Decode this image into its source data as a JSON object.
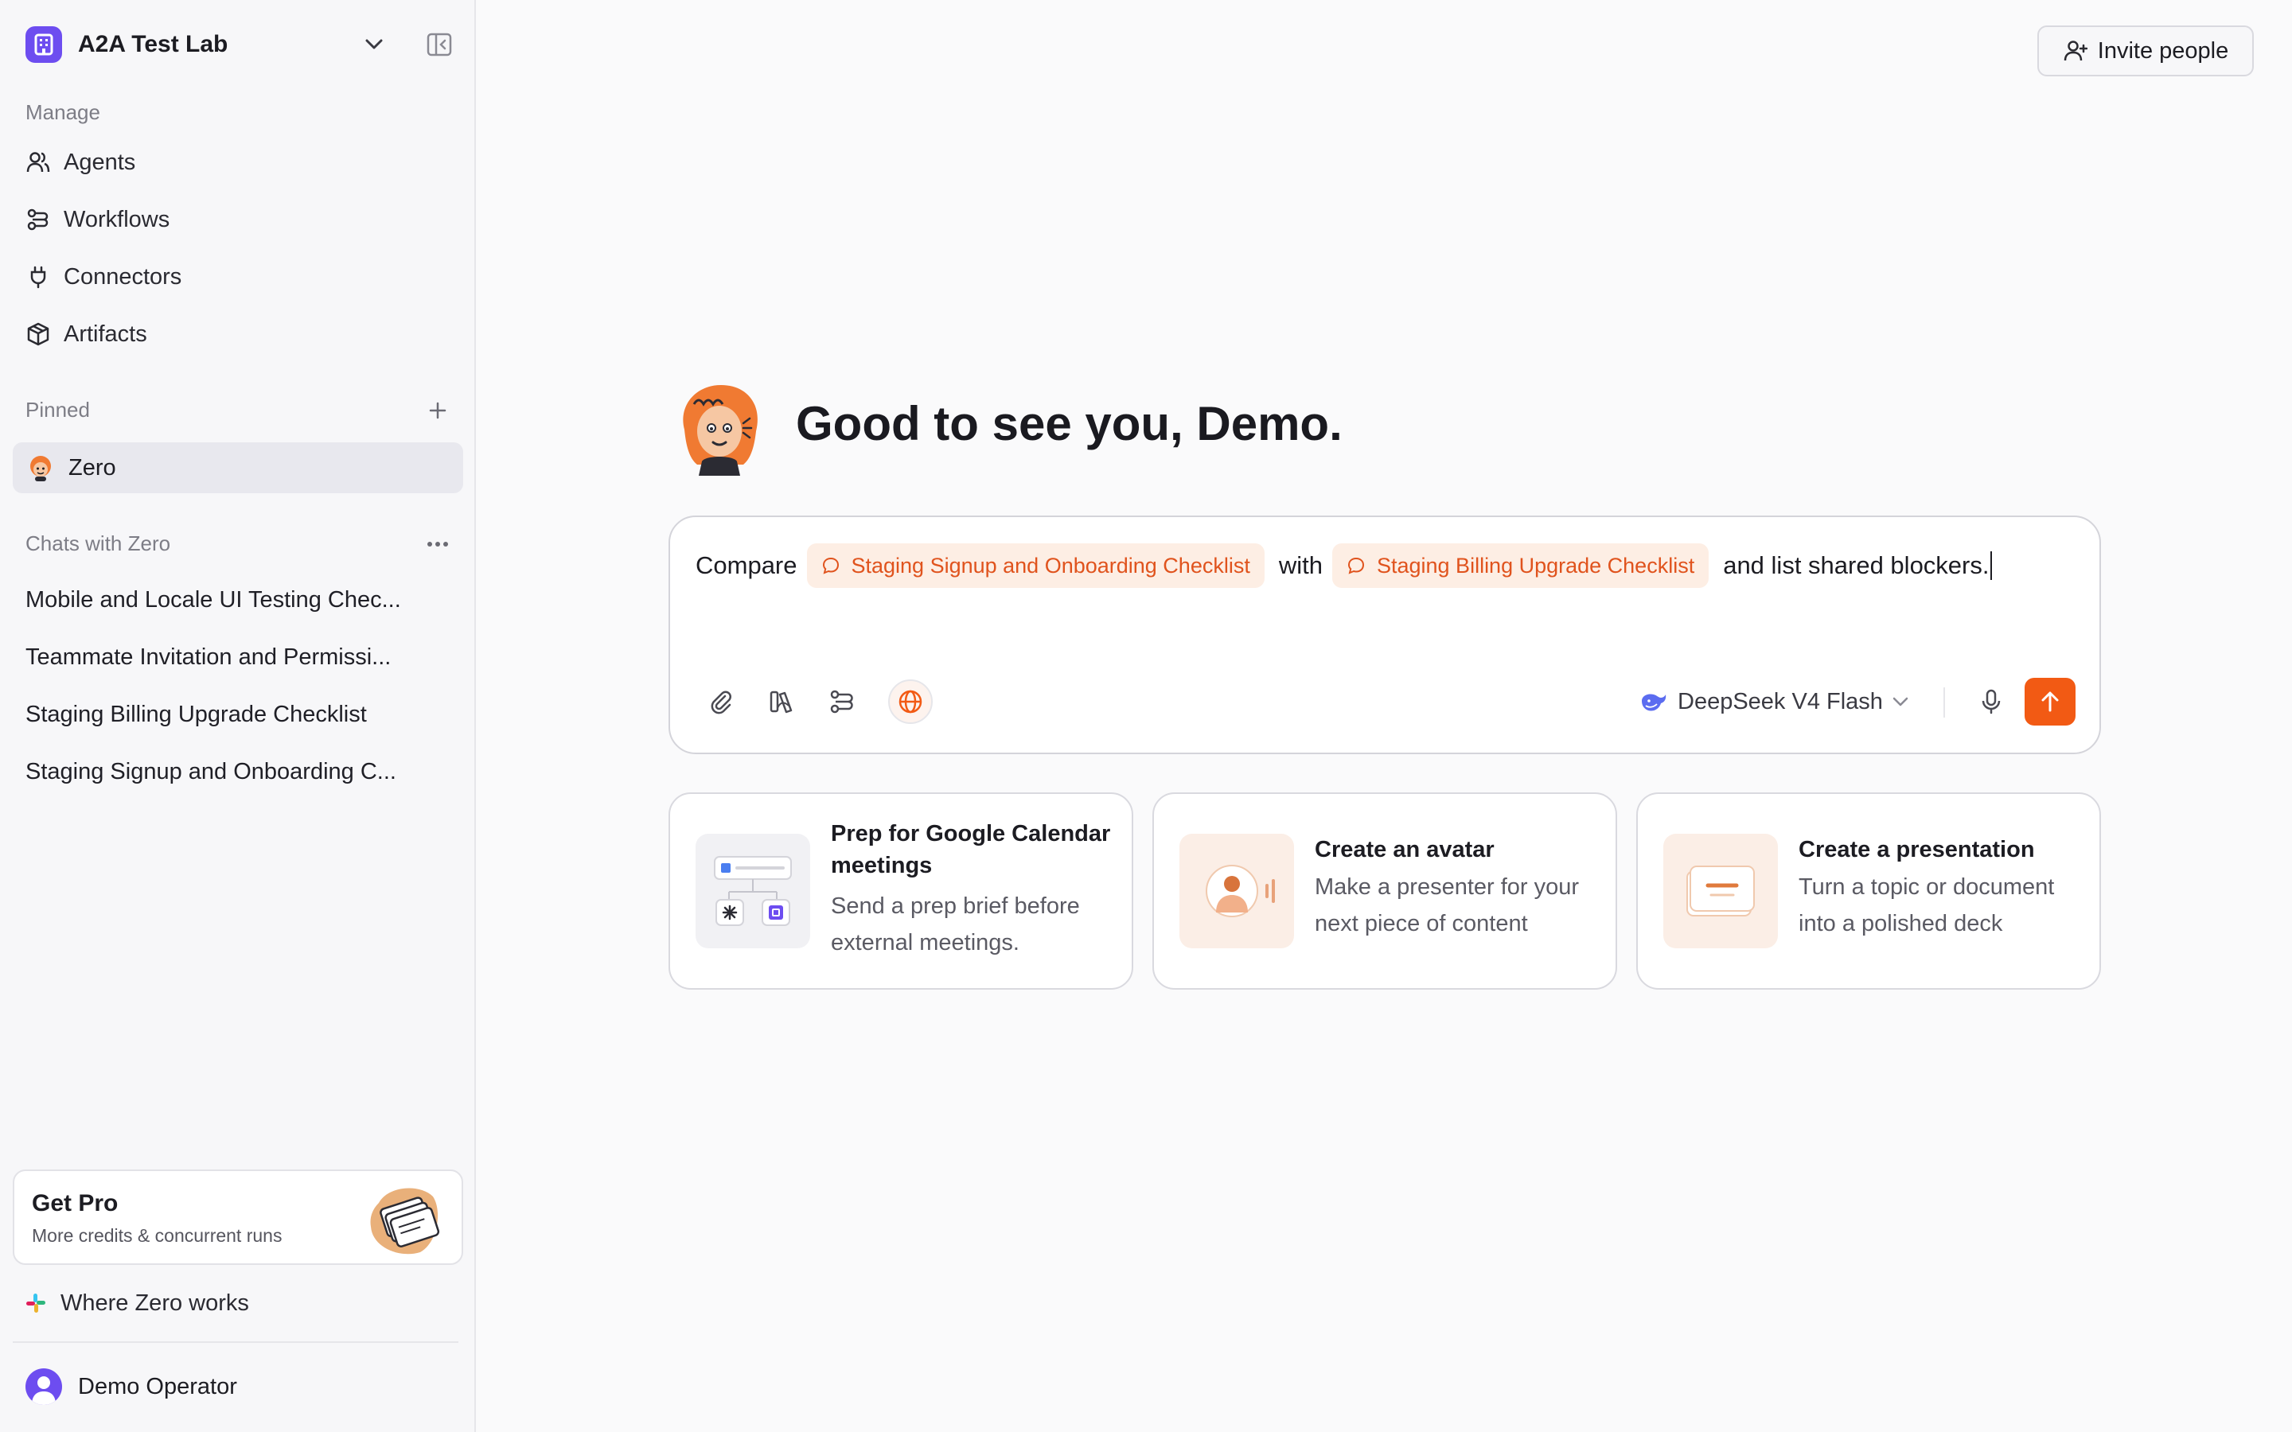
{
  "workspace": {
    "name": "A2A Test Lab",
    "logo_icon": "building-icon"
  },
  "sidebar": {
    "manage_label": "Manage",
    "manage_items": [
      {
        "label": "Agents",
        "icon": "users-icon"
      },
      {
        "label": "Workflows",
        "icon": "workflow-icon"
      },
      {
        "label": "Connectors",
        "icon": "plug-icon"
      },
      {
        "label": "Artifacts",
        "icon": "package-icon"
      }
    ],
    "pinned_label": "Pinned",
    "pinned_items": [
      {
        "label": "Zero"
      }
    ],
    "chats_label": "Chats with Zero",
    "chats": [
      "Mobile and Locale UI Testing Chec...",
      "Teammate Invitation and Permissi...",
      "Staging Billing Upgrade Checklist",
      "Staging Signup and Onboarding C..."
    ],
    "pro_card": {
      "title": "Get Pro",
      "subtitle": "More credits & concurrent runs"
    },
    "where_label": "Where Zero works",
    "user_name": "Demo Operator"
  },
  "header": {
    "invite_label": "Invite people"
  },
  "main": {
    "greeting": "Good to see you, Demo.",
    "composer": {
      "text_before": "Compare",
      "chip_1": "Staging Signup and Onboarding Checklist",
      "text_middle": "with",
      "chip_2": "Staging Billing Upgrade Checklist",
      "text_after": "and list shared blockers.",
      "model": "DeepSeek V4 Flash"
    },
    "cards": [
      {
        "title": "Prep for Google Calendar meetings",
        "description": "Send a prep brief before external meetings."
      },
      {
        "title": "Create an avatar",
        "description": "Make a presenter for your next piece of content"
      },
      {
        "title": "Create a presentation",
        "description": "Turn a topic or document into a polished deck"
      }
    ]
  },
  "colors": {
    "accent": "#f25a14",
    "brand_purple": "#6d4df0",
    "chip_bg": "#fdeee4",
    "chip_text": "#e0531d"
  }
}
